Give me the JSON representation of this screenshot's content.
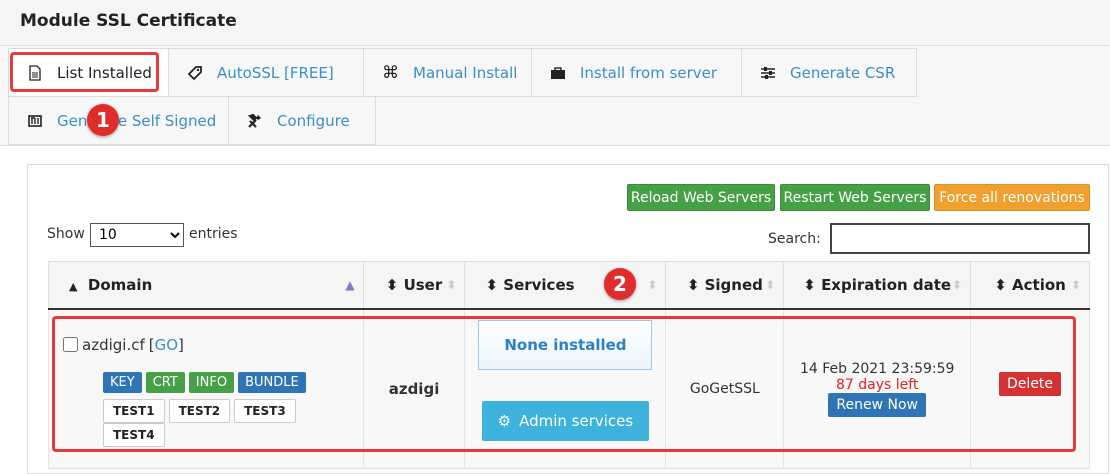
{
  "header": {
    "title": "Module SSL Certificate"
  },
  "tabs": [
    {
      "label": "List Installed",
      "icon": "document-icon",
      "active": true
    },
    {
      "label": "AutoSSL [FREE]",
      "icon": "tag-icon"
    },
    {
      "label": "Manual Install",
      "icon": "command-icon"
    },
    {
      "label": "Install from server",
      "icon": "briefcase-icon"
    },
    {
      "label": "Generate CSR",
      "icon": "sliders-icon"
    },
    {
      "label": "Generate Self Signed",
      "icon": "certificate-icon"
    },
    {
      "label": "Configure",
      "icon": "tools-icon"
    }
  ],
  "toolbar": {
    "reload": "Reload Web Servers",
    "restart": "Restart Web Servers",
    "force": "Force all renovations"
  },
  "length": {
    "show": "Show",
    "value": "10",
    "entries": "entries"
  },
  "search": {
    "label": "Search:",
    "value": ""
  },
  "table": {
    "columns": [
      "Domain",
      "User",
      "Services",
      "Signed",
      "Expiration date",
      "Action"
    ],
    "rows": [
      {
        "domain": "azdigi.cf",
        "go": "GO",
        "tags": [
          "KEY",
          "CRT",
          "INFO",
          "BUNDLE"
        ],
        "tests": [
          "TEST1",
          "TEST2",
          "TEST3",
          "TEST4"
        ],
        "user": "azdigi",
        "services": "None installed",
        "admin_services": "Admin services",
        "signed": "GoGetSSL",
        "expiration": "14 Feb 2021 23:59:59",
        "days_left": "87 days left",
        "renew": "Renew Now",
        "delete": "Delete"
      }
    ]
  },
  "annotations": [
    "1",
    "2"
  ],
  "colors": {
    "accent": "#3a8fc9",
    "green": "#45a046",
    "orange": "#f0a02e",
    "highlight": "#e63b3b"
  }
}
